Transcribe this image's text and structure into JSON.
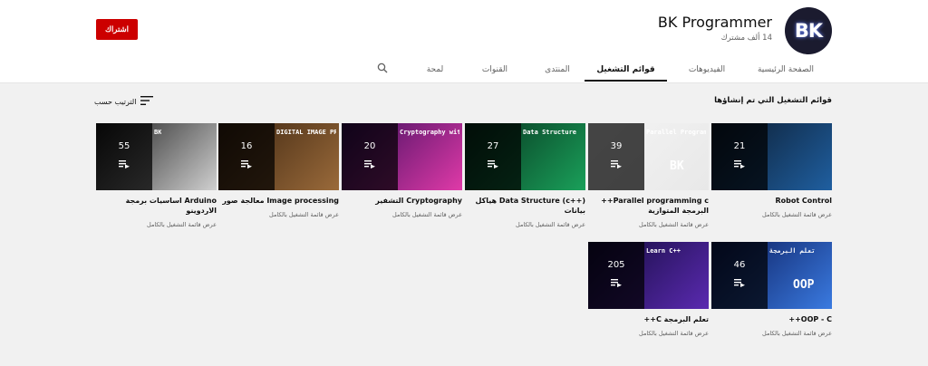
{
  "channel": {
    "name": "BK Programmer",
    "subscribers": "14 ألف مشترك",
    "avatar_text": "BK",
    "subscribe_label": "اشتراك"
  },
  "tabs": [
    {
      "label": "الصفحة الرئيسية",
      "active": false
    },
    {
      "label": "الفيديوهات",
      "active": false
    },
    {
      "label": "قوائم التشغيل",
      "active": true
    },
    {
      "label": "المنتدى",
      "active": false
    },
    {
      "label": "القنوات",
      "active": false
    },
    {
      "label": "لمحة",
      "active": false
    }
  ],
  "section": {
    "title": "قوائم التشغيل التي تم إنشاؤها",
    "sort_label": "الترتيب حسب"
  },
  "playlists": [
    {
      "title": "Robot Control",
      "count": "21",
      "link": "عرض قائمة التشغيل بالكامل",
      "colors": [
        "#0c1a2c",
        "#1f5fa0"
      ]
    },
    {
      "title": "Parallel programming c++ البرمجة المتوازية",
      "count": "39",
      "link": "عرض قائمة التشغيل بالكامل",
      "colors": [
        "#f4f4f4",
        "#e8e8e8"
      ],
      "thumb_text": "Parallel Programming",
      "thumb_text2": "BK"
    },
    {
      "title": "Data Structure (c++) هياكل بيانات",
      "count": "27",
      "link": "عرض قائمة التشغيل بالكامل",
      "colors": [
        "#06301c",
        "#1aa05a"
      ],
      "thumb_text": "Data Structure"
    },
    {
      "title": "Cryptography التشفير",
      "count": "20",
      "link": "عرض قائمة التشغيل بالكامل",
      "colors": [
        "#3a0d5c",
        "#e03aa8"
      ],
      "thumb_text": "Cryptography with BK Programmer"
    },
    {
      "title": "Image processing معالجة صور",
      "count": "16",
      "link": "عرض قائمة التشغيل بالكامل",
      "colors": [
        "#3b2410",
        "#9a6a3a"
      ],
      "thumb_text": "DIGITAL IMAGE PROCESSING"
    },
    {
      "title": "Arduino اساسيات برمجة الاردوينو",
      "count": "55",
      "link": "عرض قائمة التشغيل بالكامل",
      "colors": [
        "#1a1a1a",
        "#d0d0d0"
      ],
      "thumb_text": "BK"
    },
    {
      "title": "OOP - C++",
      "count": "46",
      "link": "عرض قائمة التشغيل بالكامل",
      "colors": [
        "#0a1a5a",
        "#3a7ae0"
      ],
      "thumb_text": "تعلم البرمجة",
      "thumb_text2": "OOP"
    },
    {
      "title": "تعلم البرمجة C++",
      "count": "205",
      "link": "عرض قائمة التشغيل بالكامل",
      "colors": [
        "#120a3a",
        "#5a2ab0"
      ],
      "thumb_text": "Learn C++"
    }
  ]
}
